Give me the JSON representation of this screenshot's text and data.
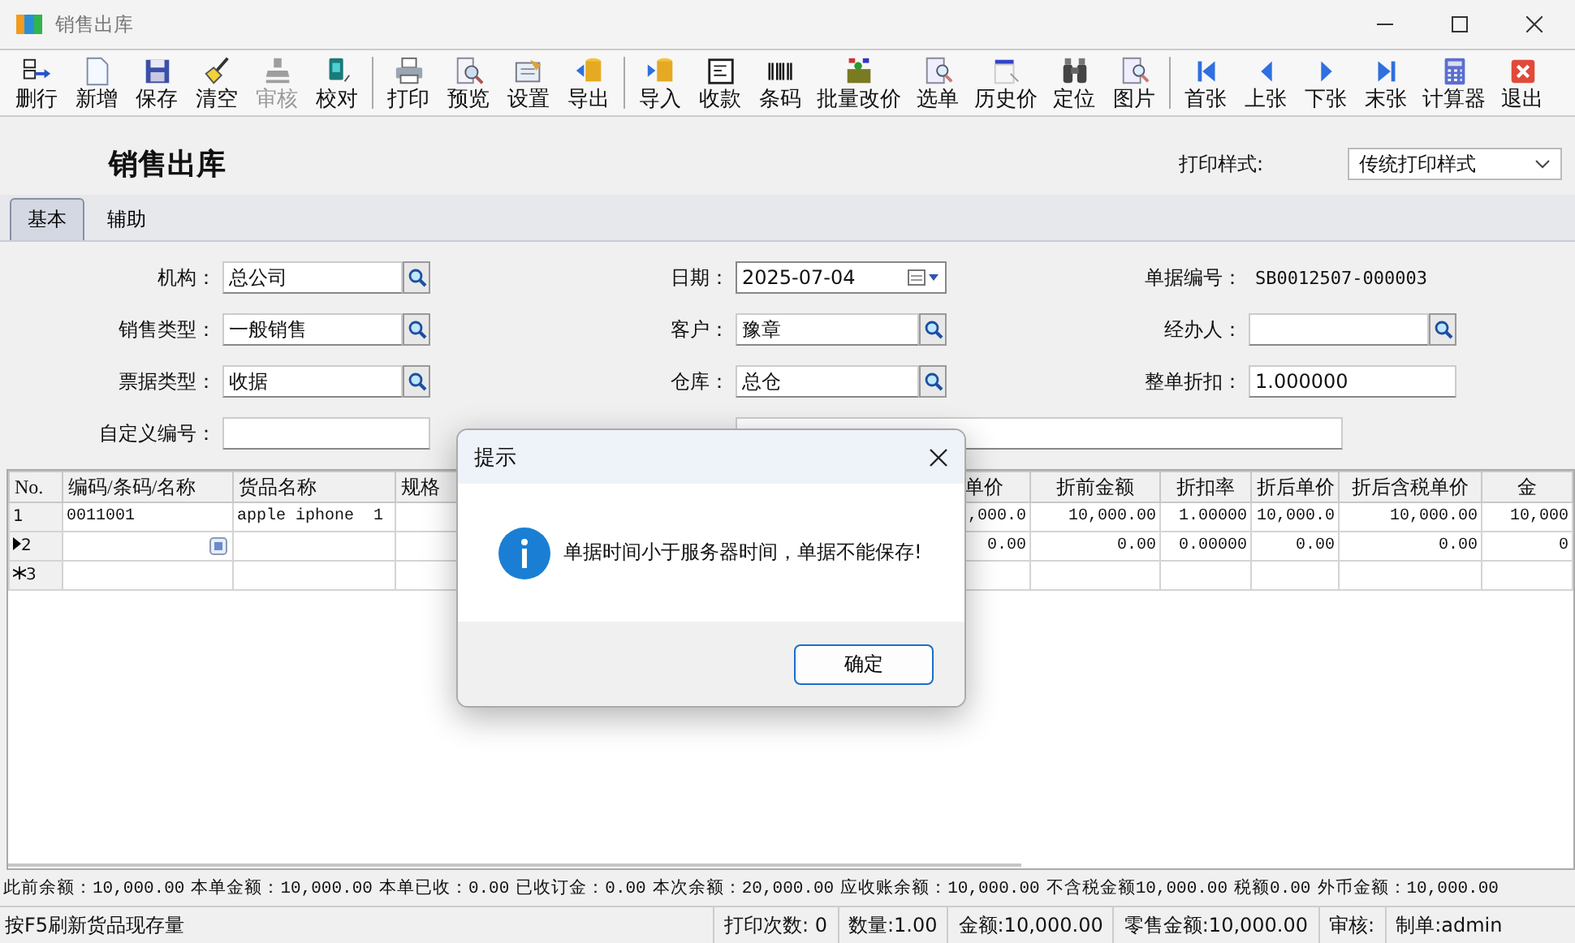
{
  "window": {
    "title": "销售出库"
  },
  "toolbar": [
    [
      {
        "label": "删行",
        "disabled": false
      },
      {
        "label": "新增",
        "disabled": false
      },
      {
        "label": "保存",
        "disabled": false
      },
      {
        "label": "清空",
        "disabled": false
      },
      {
        "label": "审核",
        "disabled": true
      },
      {
        "label": "校对",
        "disabled": false
      }
    ],
    [
      {
        "label": "打印",
        "disabled": false
      },
      {
        "label": "预览",
        "disabled": false
      },
      {
        "label": "设置",
        "disabled": false
      },
      {
        "label": "导出",
        "disabled": false
      }
    ],
    [
      {
        "label": "导入",
        "disabled": false
      },
      {
        "label": "收款",
        "disabled": false
      },
      {
        "label": "条码",
        "disabled": false
      },
      {
        "label": "批量改价",
        "disabled": false
      },
      {
        "label": "选单",
        "disabled": false
      },
      {
        "label": "历史价",
        "disabled": false
      },
      {
        "label": "定位",
        "disabled": false
      },
      {
        "label": "图片",
        "disabled": false
      }
    ],
    [
      {
        "label": "首张",
        "disabled": false
      },
      {
        "label": "上张",
        "disabled": false
      },
      {
        "label": "下张",
        "disabled": false
      },
      {
        "label": "末张",
        "disabled": false
      },
      {
        "label": "计算器",
        "disabled": false
      },
      {
        "label": "退出",
        "disabled": false
      }
    ]
  ],
  "document_title": "销售出库",
  "print_style": {
    "label": "打印样式:",
    "value": "传统打印样式"
  },
  "tabs": [
    {
      "label": "基本",
      "selected": true
    },
    {
      "label": "辅助",
      "selected": false
    }
  ],
  "form": [
    [
      {
        "kind": "lookup",
        "label": "机构：",
        "value": "总公司"
      },
      {
        "kind": "date",
        "label": "日期：",
        "value": "2025-07-04"
      },
      {
        "kind": "readonly",
        "label": "单据编号：",
        "value": "SB0012507-000003"
      }
    ],
    [
      {
        "kind": "lookup",
        "label": "销售类型：",
        "value": "一般销售"
      },
      {
        "kind": "lookup",
        "label": "客户：",
        "value": "豫章"
      },
      {
        "kind": "lookup",
        "label": "经办人："
      }
    ],
    [
      {
        "kind": "lookup",
        "label": "票据类型：",
        "value": "收据"
      },
      {
        "kind": "lookup",
        "label": "仓库：",
        "value": "总仓"
      },
      {
        "kind": "text",
        "label": "整单折扣：",
        "value": "1.000000"
      }
    ],
    [
      {
        "kind": "text",
        "label": "自定义编号："
      },
      {
        "kind": "wide"
      }
    ]
  ],
  "grid": {
    "columns": [
      "No.",
      "编码/条码/名称",
      "货品名称",
      "规格",
      "单价",
      "折前金额",
      "折扣率",
      "折后单价",
      "折后含税单价",
      "金"
    ],
    "rows": [
      {
        "kind": "plain",
        "number": "1",
        "cells": [
          "0011001",
          "apple iphone  1",
          null,
          ",000.0",
          "10,000.00",
          "1.00000",
          "10,000.0",
          "10,000.00",
          "10,000"
        ]
      },
      {
        "kind": "current",
        "number": "2",
        "cells": [
          null,
          null,
          null,
          "0.00",
          "0.00",
          "0.00000",
          "0.00",
          "0.00",
          "0"
        ]
      },
      {
        "kind": "new",
        "number": "3"
      }
    ]
  },
  "summary": [
    "此前余额：10,000.00",
    "本单金额：10,000.00",
    "本单已收：0.00",
    "已收订金：0.00",
    "本次余额：20,000.00",
    "应收账余额：10,000.00",
    "不含税金额10,000.00",
    "税额0.00",
    "外币金额：10,000.00"
  ],
  "status_bar": [
    "按F5刷新货品现存量",
    "打印次数: 0",
    "数量:1.00",
    "金额:10,000.00",
    "零售金额:10,000.00",
    "审核:",
    "制单:admin"
  ],
  "dialog": {
    "title": "提示",
    "message": "单据时间小于服务器时间，单据不能保存!",
    "button": "确定"
  }
}
